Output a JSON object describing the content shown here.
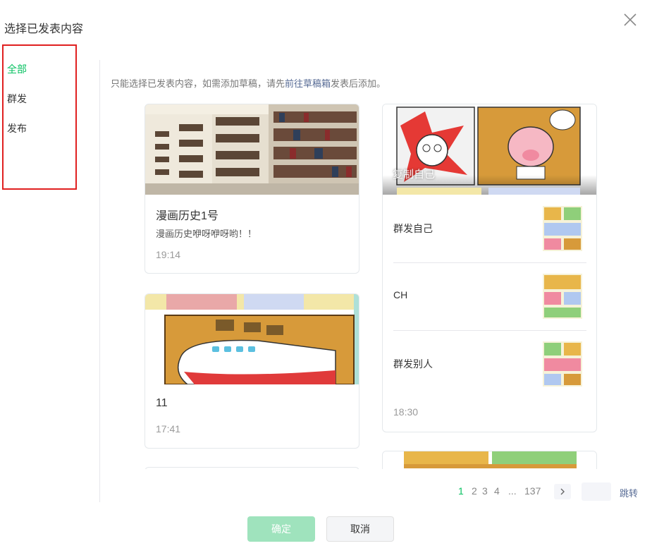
{
  "dialog": {
    "title": "选择已发表内容"
  },
  "sidebar": {
    "items": [
      {
        "label": "全部",
        "active": true
      },
      {
        "label": "群发",
        "active": false
      },
      {
        "label": "发布",
        "active": false
      }
    ]
  },
  "hint": {
    "prefix": "只能选择已发表内容，如需添加草稿，请先",
    "link": "前往草稿箱",
    "suffix": "发表后添加。"
  },
  "cards": {
    "card1": {
      "title": "漫画历史1号",
      "digest": "漫画历史咿呀咿呀哟！！",
      "time": "19:14",
      "cover": "library-bookshelves-photo"
    },
    "card2": {
      "title": "11",
      "time": "17:41",
      "cover": "comic-airplane-image"
    },
    "card3": {
      "cover_caption": "复制自己",
      "cover": "comic-pig-image",
      "items": [
        {
          "title": "群发自己"
        },
        {
          "title": "CH"
        },
        {
          "title": "群发别人"
        }
      ],
      "time": "18:30"
    }
  },
  "pagination": {
    "pages": [
      "1",
      "2",
      "3",
      "4"
    ],
    "ellipsis": "...",
    "last": "137",
    "current": "1",
    "jump_label": "跳转"
  },
  "buttons": {
    "confirm": "确定",
    "cancel": "取消"
  },
  "colors": {
    "accent": "#07c160",
    "link": "#576b95",
    "highlight_border": "#e02020",
    "confirm_disabled": "#9fe3bd"
  }
}
